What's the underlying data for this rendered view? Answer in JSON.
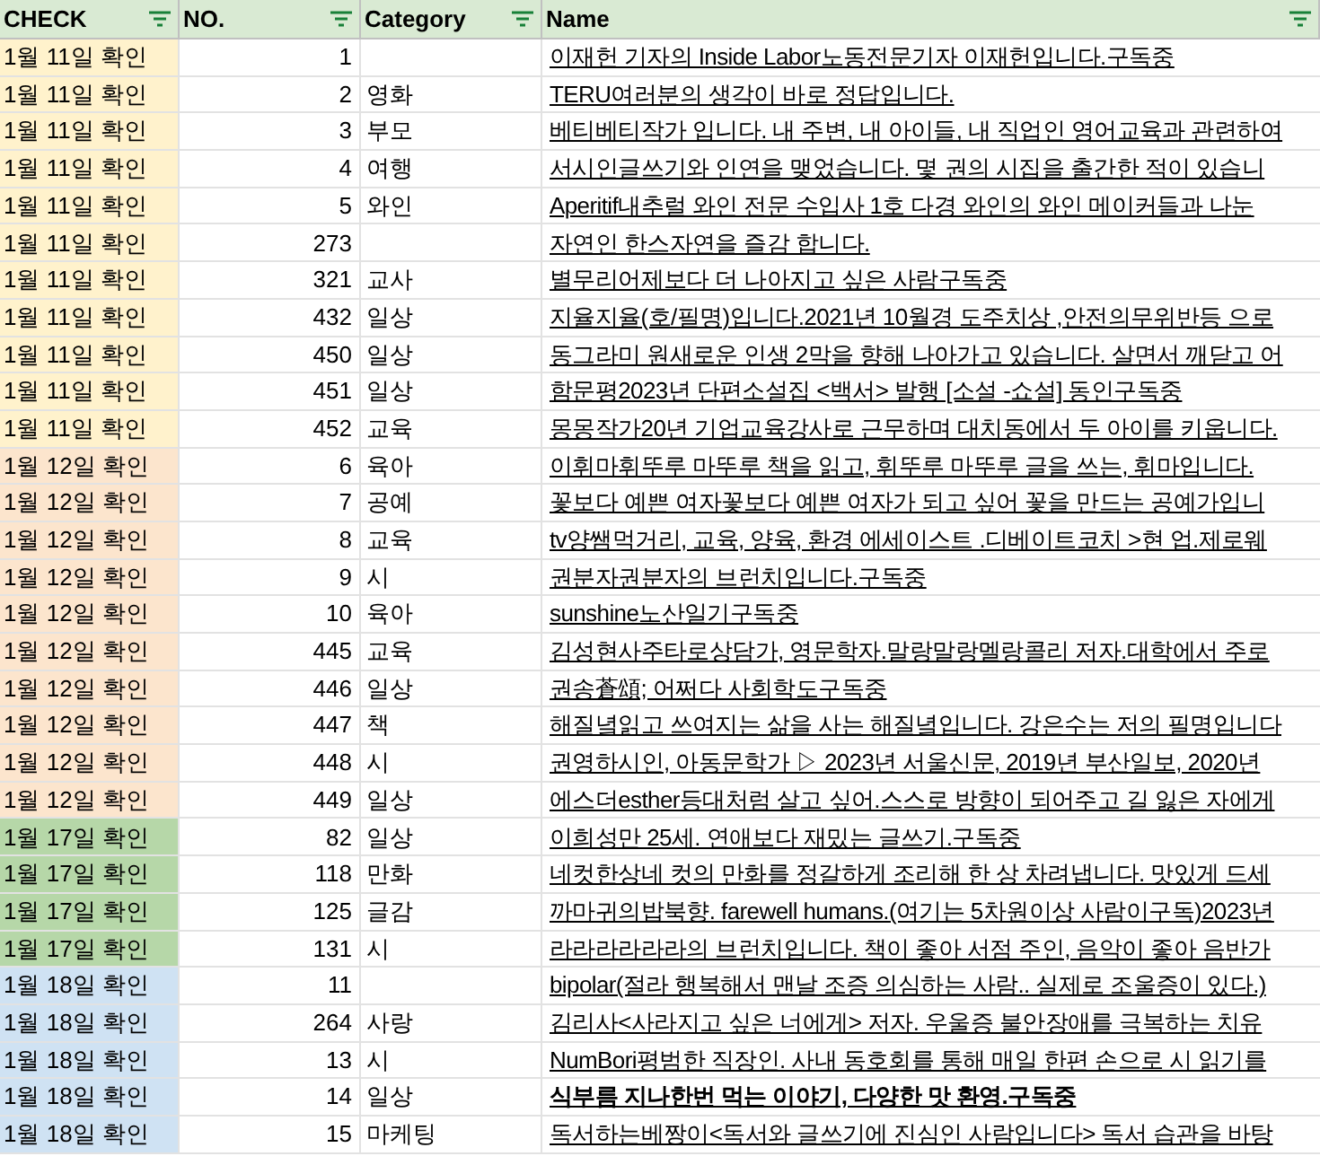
{
  "table": {
    "columns": [
      {
        "label": "CHECK"
      },
      {
        "label": "NO."
      },
      {
        "label": "Category"
      },
      {
        "label": "Name"
      }
    ],
    "rows": [
      {
        "check": "1월 11일 확인",
        "color": "#fff2cc",
        "no": "1",
        "category": "",
        "name": "이재헌 기자의 Inside Labor노동전문기자 이재헌입니다.구독중",
        "bold": false
      },
      {
        "check": "1월 11일 확인",
        "color": "#fff2cc",
        "no": "2",
        "category": "영화",
        "name": "TERU여러분의 생각이 바로 정답입니다.",
        "bold": false
      },
      {
        "check": "1월 11일 확인",
        "color": "#fff2cc",
        "no": "3",
        "category": "부모",
        "name": "베티베티작가 입니다. 내 주변, 내 아이들, 내 직업인 영어교육과 관련하여",
        "bold": false
      },
      {
        "check": "1월 11일 확인",
        "color": "#fff2cc",
        "no": "4",
        "category": "여행",
        "name": "서시인글쓰기와 인연을 맺었습니다. 몇 권의 시집을 출간한 적이 있습니",
        "bold": false
      },
      {
        "check": "1월 11일 확인",
        "color": "#fff2cc",
        "no": "5",
        "category": "와인",
        "name": "Aperitif내추럴 와인 전문 수입사 1호 다경 와인의 와인 메이커들과 나눈",
        "bold": false
      },
      {
        "check": "1월 11일 확인",
        "color": "#fff2cc",
        "no": "273",
        "category": "",
        "name": "자연인 한스자연을 즐감 합니다.",
        "bold": false
      },
      {
        "check": "1월 11일 확인",
        "color": "#fff2cc",
        "no": "321",
        "category": "교사",
        "name": "별무리어제보다 더 나아지고 싶은 사람구독중",
        "bold": false
      },
      {
        "check": "1월 11일 확인",
        "color": "#fff2cc",
        "no": "432",
        "category": "일상",
        "name": "지율지율(호/필명)입니다.2021년 10월경 도주치상 ,안전의무위반등 으로",
        "bold": false
      },
      {
        "check": "1월 11일 확인",
        "color": "#fff2cc",
        "no": "450",
        "category": "일상",
        "name": "동그라미 원새로운 인생 2막을 향해 나아가고 있습니다. 살면서 깨닫고 어",
        "bold": false
      },
      {
        "check": "1월 11일 확인",
        "color": "#fff2cc",
        "no": "451",
        "category": "일상",
        "name": "함문평2023년 단편소설집 <백서> 발행 [소설 -쇼설] 동인구독중",
        "bold": false
      },
      {
        "check": "1월 11일 확인",
        "color": "#fff2cc",
        "no": "452",
        "category": "교육",
        "name": "몽몽작가20년 기업교육강사로 근무하며 대치동에서 두 아이를 키웁니다.",
        "bold": false
      },
      {
        "check": "1월 12일 확인",
        "color": "#fce5cd",
        "no": "6",
        "category": "육아",
        "name": "이휘마휘뚜루 마뚜루 책을 읽고, 휘뚜루 마뚜루 글을 쓰는, 휘마입니다.",
        "bold": false
      },
      {
        "check": "1월 12일 확인",
        "color": "#fce5cd",
        "no": "7",
        "category": "공예",
        "name": "꽃보다 예쁜 여자꽃보다 예쁜 여자가 되고 싶어 꽃을 만드는 공예가입니",
        "bold": false
      },
      {
        "check": "1월 12일 확인",
        "color": "#fce5cd",
        "no": "8",
        "category": "교육",
        "name": "tv양쌤먹거리, 교육, 양육, 환경 에세이스트 .디베이트코치 >현 업.제로웨",
        "bold": false
      },
      {
        "check": "1월 12일 확인",
        "color": "#fce5cd",
        "no": "9",
        "category": "시",
        "name": "권분자권분자의 브런치입니다.구독중",
        "bold": false
      },
      {
        "check": "1월 12일 확인",
        "color": "#fce5cd",
        "no": "10",
        "category": "육아",
        "name": "sunshine노산일기구독중",
        "bold": false
      },
      {
        "check": "1월 12일 확인",
        "color": "#fce5cd",
        "no": "445",
        "category": "교육",
        "name": "김성현사주타로상담가, 영문학자.말랑말랑멜랑콜리 저자.대학에서 주로",
        "bold": false
      },
      {
        "check": "1월 12일 확인",
        "color": "#fce5cd",
        "no": "446",
        "category": "일상",
        "name": "권송蒼頌; 어쩌다 사회학도구독중",
        "bold": false
      },
      {
        "check": "1월 12일 확인",
        "color": "#fce5cd",
        "no": "447",
        "category": "책",
        "name": "해질녘읽고 쓰여지는 삶을 사는 해질녘입니다. 강은수는 저의 필명입니다",
        "bold": false
      },
      {
        "check": "1월 12일 확인",
        "color": "#fce5cd",
        "no": "448",
        "category": "시",
        "name": "권영하시인, 아동문학가 ▷ 2023년 서울신문, 2019년 부산일보, 2020년",
        "bold": false
      },
      {
        "check": "1월 12일 확인",
        "color": "#fce5cd",
        "no": "449",
        "category": "일상",
        "name": "에스더esther등대처럼 살고 싶어.스스로 방향이 되어주고 길 잃은 자에게",
        "bold": false
      },
      {
        "check": "1월 17일 확인",
        "color": "#b6d7a8",
        "no": "82",
        "category": "일상",
        "name": "이희성만 25세. 연애보다 재밌는 글쓰기.구독중",
        "bold": false
      },
      {
        "check": "1월 17일 확인",
        "color": "#b6d7a8",
        "no": "118",
        "category": "만화",
        "name": "네컷한상네 컷의 만화를 정갈하게 조리해 한 상 차려냅니다. 맛있게 드세",
        "bold": false
      },
      {
        "check": "1월 17일 확인",
        "color": "#b6d7a8",
        "no": "125",
        "category": "글감",
        "name": "까마귀의밥북향. farewell humans.(여기는 5차원이상 사람이구독)2023년",
        "bold": false
      },
      {
        "check": "1월 17일 확인",
        "color": "#b6d7a8",
        "no": "131",
        "category": "시",
        "name": "라라라라라라의 브런치입니다. 책이 좋아 서점 주인, 음악이 좋아 음반가",
        "bold": false
      },
      {
        "check": "1월 18일 확인",
        "color": "#cfe2f3",
        "no": "11",
        "category": "",
        "name": "bipolar(절라 행복해서 맨날 조증 의심하는 사람.. 실제로 조울증이 있다.)",
        "bold": false
      },
      {
        "check": "1월 18일 확인",
        "color": "#cfe2f3",
        "no": "264",
        "category": "사랑",
        "name": "김리사<사라지고 싶은 너에게> 저자. 우울증 불안장애를 극복하는 치유",
        "bold": false
      },
      {
        "check": "1월 18일 확인",
        "color": "#cfe2f3",
        "no": "13",
        "category": "시",
        "name": "NumBori평범한 직장인. 사내 동호회를 통해 매일 한편 손으로 시 읽기를",
        "bold": false
      },
      {
        "check": "1월 18일 확인",
        "color": "#cfe2f3",
        "no": "14",
        "category": "일상",
        "name": "식부름 지나한번 먹는 이야기, 다양한 맛 환영.구독중",
        "bold": true
      },
      {
        "check": "1월 18일 확인",
        "color": "#cfe2f3",
        "no": "15",
        "category": "마케팅",
        "name": "독서하는베짱이<독서와 글쓰기에 진심인 사람입니다> 독서 습관을 바탕",
        "bold": false
      }
    ]
  }
}
